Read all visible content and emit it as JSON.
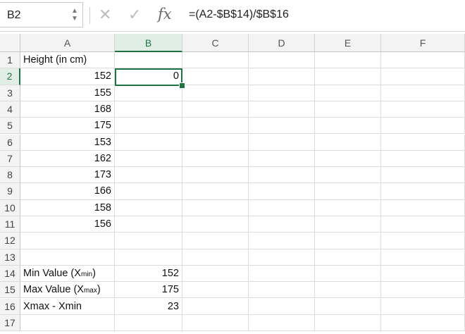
{
  "formula_bar": {
    "name_box": "B2",
    "cancel_icon": "x-icon",
    "enter_icon": "check-icon",
    "fx_label": "fx",
    "formula": "=(A2-$B$14)/$B$16"
  },
  "columns": [
    "A",
    "B",
    "C",
    "D",
    "E",
    "F"
  ],
  "selected_column": "B",
  "rows": [
    "1",
    "2",
    "3",
    "4",
    "5",
    "6",
    "7",
    "8",
    "9",
    "10",
    "11",
    "12",
    "13",
    "14",
    "15",
    "16",
    "17"
  ],
  "selected_row": "2",
  "cells": {
    "A1": "Height (in cm)",
    "A2": "152",
    "A3": "155",
    "A4": "168",
    "A5": "175",
    "A6": "153",
    "A7": "162",
    "A8": "173",
    "A9": "166",
    "A10": "158",
    "A11": "156",
    "A14_main": "Min Value (X",
    "A14_sub": "min",
    "A14_end": ")",
    "A15_main": "Max Value (X",
    "A15_sub": "max",
    "A15_end": ")",
    "A16": "Xmax - Xmin",
    "B2": "0",
    "B14": "152",
    "B15": "175",
    "B16": "23"
  },
  "colors": {
    "accent": "#217346",
    "header_bg": "#f3f3f3",
    "selected_header_bg": "#e1eee5"
  }
}
